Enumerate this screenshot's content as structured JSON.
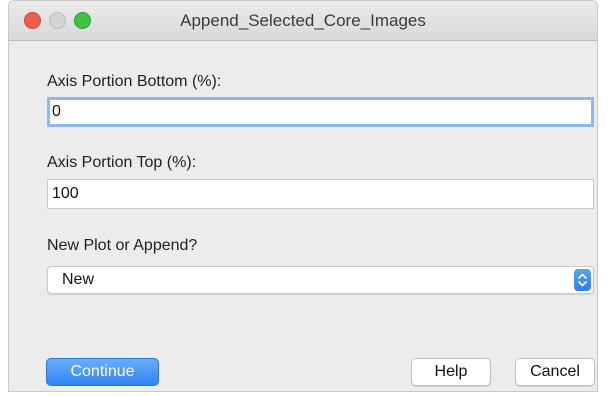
{
  "window": {
    "title": "Append_Selected_Core_Images"
  },
  "form": {
    "axis_bottom": {
      "label": "Axis Portion Bottom (%):",
      "value": "0"
    },
    "axis_top": {
      "label": "Axis Portion Top (%):",
      "value": "100"
    },
    "plot_mode": {
      "label": "New Plot or Append?",
      "selected": "New"
    }
  },
  "buttons": {
    "continue_label": "Continue",
    "help_label": "Help",
    "cancel_label": "Cancel"
  },
  "icons": {
    "close": "close-icon",
    "minimize": "minimize-icon",
    "zoom": "zoom-icon",
    "stepper": "up-down-chevron-icon"
  },
  "colors": {
    "accent": "#2f84f2",
    "focus_ring": "#8fb8ee",
    "close": "#ee5b52",
    "zoom": "#3fc14a"
  }
}
